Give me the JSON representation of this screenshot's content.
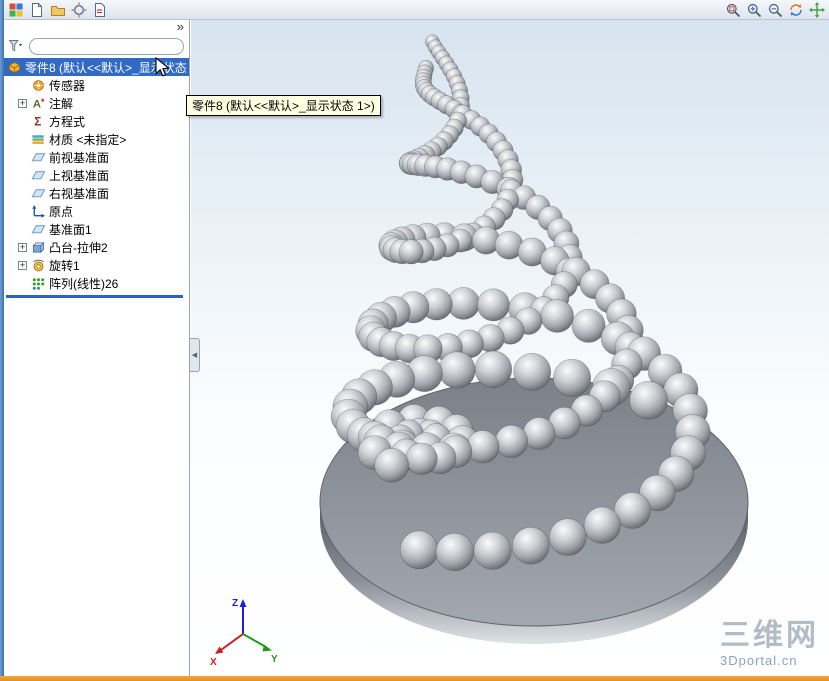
{
  "window": {
    "accent": {
      "selection": "#316ac5",
      "rollback": "#2a62c8",
      "taskbar": "#f2a63a",
      "border_blue": "#6f9fd4"
    }
  },
  "toolbar": {
    "left_icons": [
      {
        "id": "view-selector"
      },
      {
        "id": "new-document"
      },
      {
        "id": "open-document"
      },
      {
        "id": "select-target"
      },
      {
        "id": "document-properties"
      }
    ],
    "right_icons": [
      {
        "id": "zoom-fit"
      },
      {
        "id": "zoom-area"
      },
      {
        "id": "zoom-inout"
      },
      {
        "id": "rotate-view"
      },
      {
        "id": "pan"
      }
    ]
  },
  "panel": {
    "chevron": "»",
    "filter_placeholder": ""
  },
  "tree": {
    "items": [
      {
        "id": "part-root",
        "icon": "part",
        "label": "零件8 (默认<<默认>_显示状态",
        "selected": true,
        "root": true,
        "expander": false
      },
      {
        "id": "sensors",
        "icon": "sensors",
        "label": "传感器",
        "expander": false
      },
      {
        "id": "annotations",
        "icon": "annotations",
        "label": "注解",
        "expander": true
      },
      {
        "id": "equations",
        "icon": "equations",
        "label": "方程式",
        "expander": false
      },
      {
        "id": "material",
        "icon": "material",
        "label": "材质 <未指定>",
        "expander": false
      },
      {
        "id": "front-plane",
        "icon": "plane",
        "label": "前视基准面",
        "expander": false
      },
      {
        "id": "top-plane",
        "icon": "plane",
        "label": "上视基准面",
        "expander": false
      },
      {
        "id": "right-plane",
        "icon": "plane",
        "label": "右视基准面",
        "expander": false
      },
      {
        "id": "origin",
        "icon": "origin",
        "label": "原点",
        "expander": false
      },
      {
        "id": "plane1",
        "icon": "plane",
        "label": "基准面1",
        "expander": false
      },
      {
        "id": "boss-extrude2",
        "icon": "extrude",
        "label": "凸台-拉伸2",
        "expander": true
      },
      {
        "id": "revolve1",
        "icon": "revolve",
        "label": "旋转1",
        "expander": true
      },
      {
        "id": "pattern-linear26",
        "icon": "pattern",
        "label": "阵列(线性)26",
        "expander": false
      }
    ]
  },
  "tooltip": {
    "text": "零件8 (默认<<默认>_显示状态 1>)"
  },
  "triad": {
    "x": "X",
    "y": "Y",
    "z": "Z",
    "x_color": "#cc2020",
    "y_color": "#1f9a1f",
    "z_color": "#2222cc"
  },
  "watermark": {
    "line1": "三维网",
    "line2": "3Dportal.cn"
  },
  "viewport": {
    "bg_top": "#d7e3ef",
    "bg_bottom": "#ffffff",
    "plate": {
      "top_dark": "#7c8189",
      "top_light": "#a2a8b0",
      "side_dark": "#565a60",
      "side_light": "#dfe3e7"
    },
    "ball": {
      "hi": "#fafbfc",
      "mid": "#a0a4aa",
      "dark": "#54585e"
    }
  }
}
